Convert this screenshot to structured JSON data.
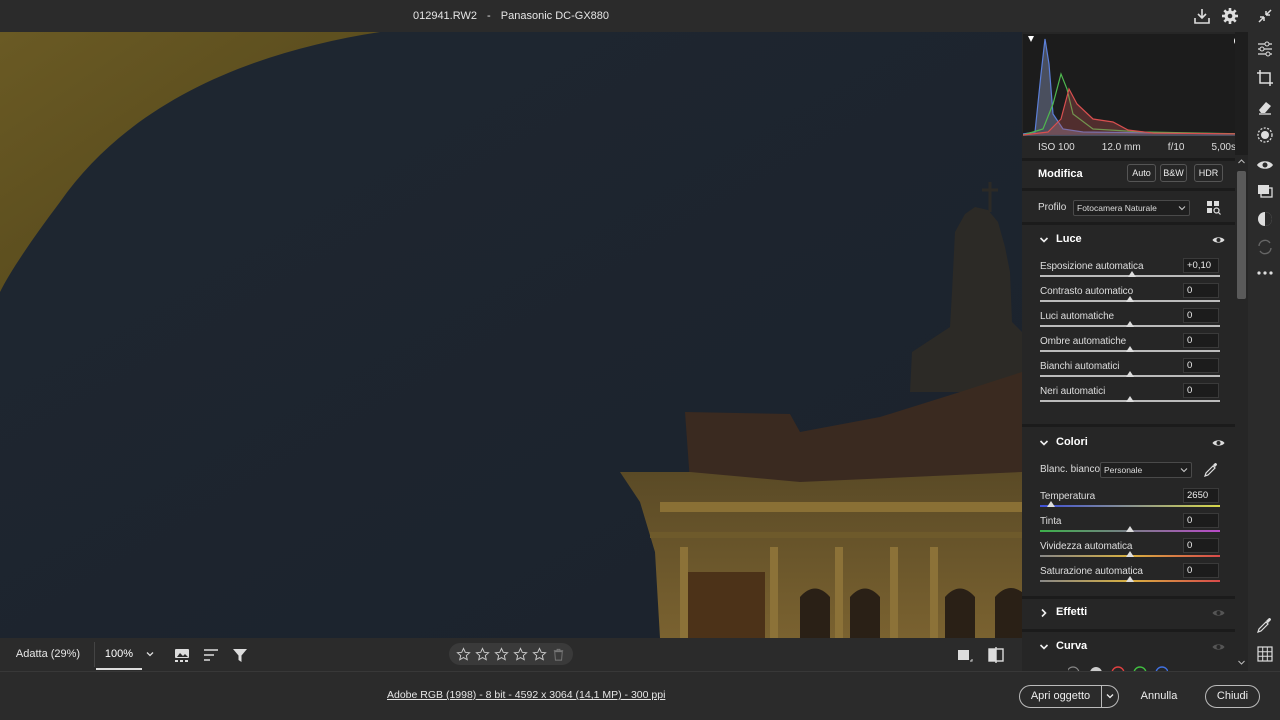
{
  "window": {
    "filename": "012941.RW2",
    "separator": "-",
    "camera": "Panasonic DC-GX880"
  },
  "bottom_toolbar": {
    "zoom_fit": "Adatta (29%)",
    "zoom_100": "100%"
  },
  "rating": {
    "stars": 0,
    "max": 5
  },
  "status": {
    "info_link": "Adobe RGB (1998) - 8 bit - 4592 x 3064 (14,1 MP) - 300 ppi",
    "open_button": "Apri oggetto",
    "cancel_button": "Annulla",
    "done_button": "Chiudi"
  },
  "exif": {
    "iso": "ISO 100",
    "focal": "12.0 mm",
    "aperture": "f/10",
    "shutter": "5,00s"
  },
  "edit": {
    "title": "Modifica",
    "auto_label": "Auto",
    "bw_label": "B&W",
    "hdr_label": "HDR",
    "profile_label": "Profilo",
    "profile_value": "Fotocamera Naturale"
  },
  "light": {
    "title": "Luce",
    "sliders": [
      {
        "label": "Esposizione automatica",
        "value": "+0,10",
        "position": 0.51
      },
      {
        "label": "Contrasto automatico",
        "value": "0",
        "position": 0.5
      },
      {
        "label": "Luci automatiche",
        "value": "0",
        "position": 0.5
      },
      {
        "label": "Ombre automatiche",
        "value": "0",
        "position": 0.5
      },
      {
        "label": "Bianchi automatici",
        "value": "0",
        "position": 0.5
      },
      {
        "label": "Neri automatici",
        "value": "0",
        "position": 0.5
      }
    ]
  },
  "color": {
    "title": "Colori",
    "wb_label": "Blanc. bianco",
    "wb_value": "Personale",
    "sliders": [
      {
        "label": "Temperatura",
        "value": "2650",
        "position": 0.06
      },
      {
        "label": "Tinta",
        "value": "0",
        "position": 0.5
      },
      {
        "label": "Vividezza automatica",
        "value": "0",
        "position": 0.5
      },
      {
        "label": "Saturazione automatica",
        "value": "0",
        "position": 0.5
      }
    ]
  },
  "effects": {
    "title": "Effetti"
  },
  "curve": {
    "title": "Curva"
  },
  "colors": {
    "accent": "#e6e6e6",
    "panel_bg": "#262626",
    "chrome_bg": "#2b2b2b"
  }
}
